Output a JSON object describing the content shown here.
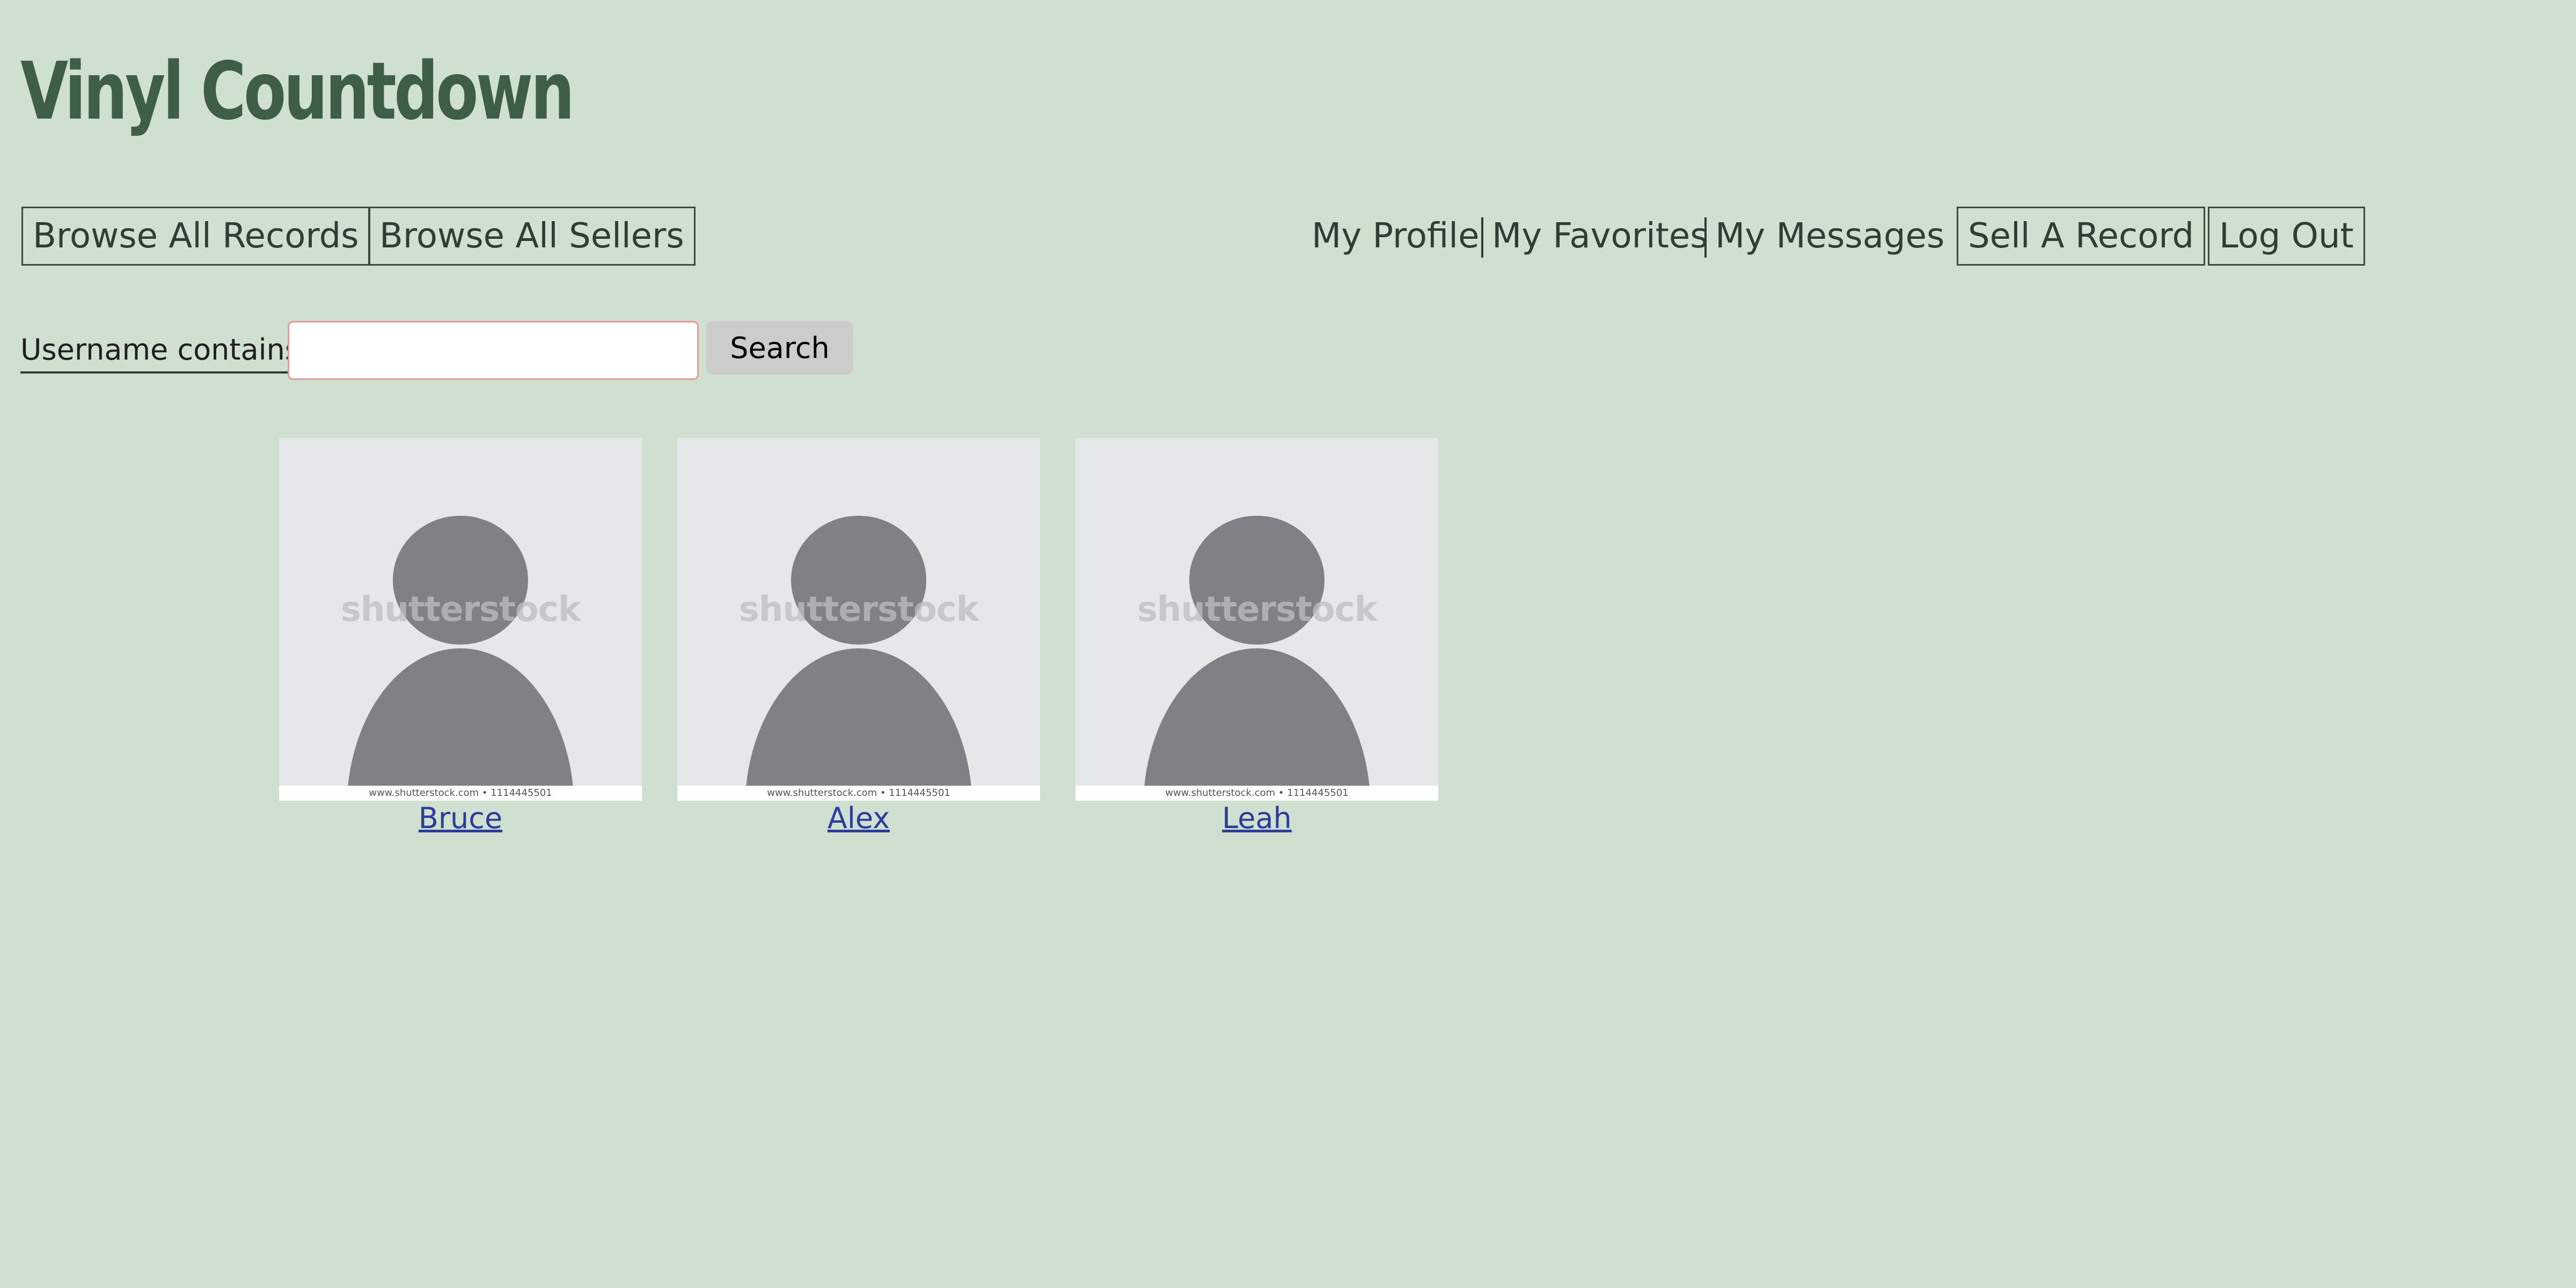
{
  "site": {
    "title": "Vinyl Countdown"
  },
  "nav": {
    "browse_records": "Browse All Records",
    "browse_sellers": "Browse All Sellers",
    "my_profile": "My Profile",
    "my_favorites": "My Favorites",
    "my_messages": "My Messages",
    "sell_record": "Sell A Record",
    "log_out": "Log Out"
  },
  "search": {
    "label": "Username contains",
    "value": "",
    "button_label": "Search"
  },
  "sellers": [
    {
      "name": "Bruce",
      "watermark": "shutterstock",
      "caption": "www.shutterstock.com • 1114445501"
    },
    {
      "name": "Alex",
      "watermark": "shutterstock",
      "caption": "www.shutterstock.com • 1114445501"
    },
    {
      "name": "Leah",
      "watermark": "shutterstock",
      "caption": "www.shutterstock.com • 1114445501"
    }
  ],
  "colors": {
    "background": "#cfdfd0",
    "title": "#3f5e48",
    "link": "#2b3c9a"
  }
}
